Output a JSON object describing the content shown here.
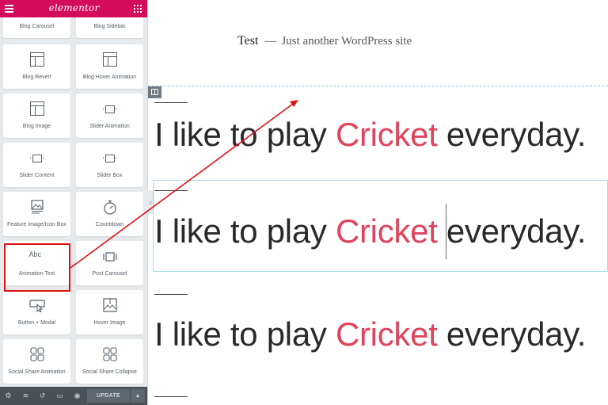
{
  "app": {
    "logo_text": "elementor",
    "brand_color": "#d30c5c",
    "menu_icon": "hamburger-icon",
    "widgets_icon": "grid-icon"
  },
  "widgets": [
    {
      "label": "Blog Carousel",
      "icon": "blog-icon"
    },
    {
      "label": "Blog Sidebar",
      "icon": "blog-icon"
    },
    {
      "label": "Blog Revert",
      "icon": "blog-icon"
    },
    {
      "label": "Blog Hover Animation",
      "icon": "blog-icon"
    },
    {
      "label": "Blog Image",
      "icon": "blog-icon"
    },
    {
      "label": "Slider Animation",
      "icon": "slider-icon"
    },
    {
      "label": "Slider Content",
      "icon": "slider-icon"
    },
    {
      "label": "Slider Box",
      "icon": "slider-icon"
    },
    {
      "label": "Feature Image/Icon Box",
      "icon": "image-icon"
    },
    {
      "label": "Countdown",
      "icon": "stopwatch-icon"
    },
    {
      "label": "Animation Text",
      "icon": "text-cursor-icon",
      "icon_text": "Abc"
    },
    {
      "label": "Post Carousel",
      "icon": "carousel-icon"
    },
    {
      "label": "Button + Modal",
      "icon": "button-pointer-icon"
    },
    {
      "label": "Hover Image",
      "icon": "hover-image-icon"
    },
    {
      "label": "Social Share Animation",
      "icon": "social-icon"
    },
    {
      "label": "Social Share Collapse",
      "icon": "social-icon"
    }
  ],
  "bottom_bar": {
    "icons": [
      "settings-icon",
      "layers-icon",
      "history-icon",
      "responsive-icon",
      "preview-icon"
    ],
    "update_label": "UPDATE",
    "arrow_label": "▲"
  },
  "site": {
    "title": "Test",
    "separator": "—",
    "tagline": "Just another WordPress site"
  },
  "headlines": [
    {
      "before": "I like to play ",
      "highlight": "Cricket",
      "after": " everyday."
    },
    {
      "before": "I like to play ",
      "highlight": "Cricket",
      "after": " everyday."
    },
    {
      "before": "I like to play ",
      "highlight": "Cricket",
      "after": " everyday."
    }
  ],
  "colors": {
    "highlight_word": "#e0435c",
    "annotation": "#e01010",
    "editor_outline": "#a9dce8"
  }
}
